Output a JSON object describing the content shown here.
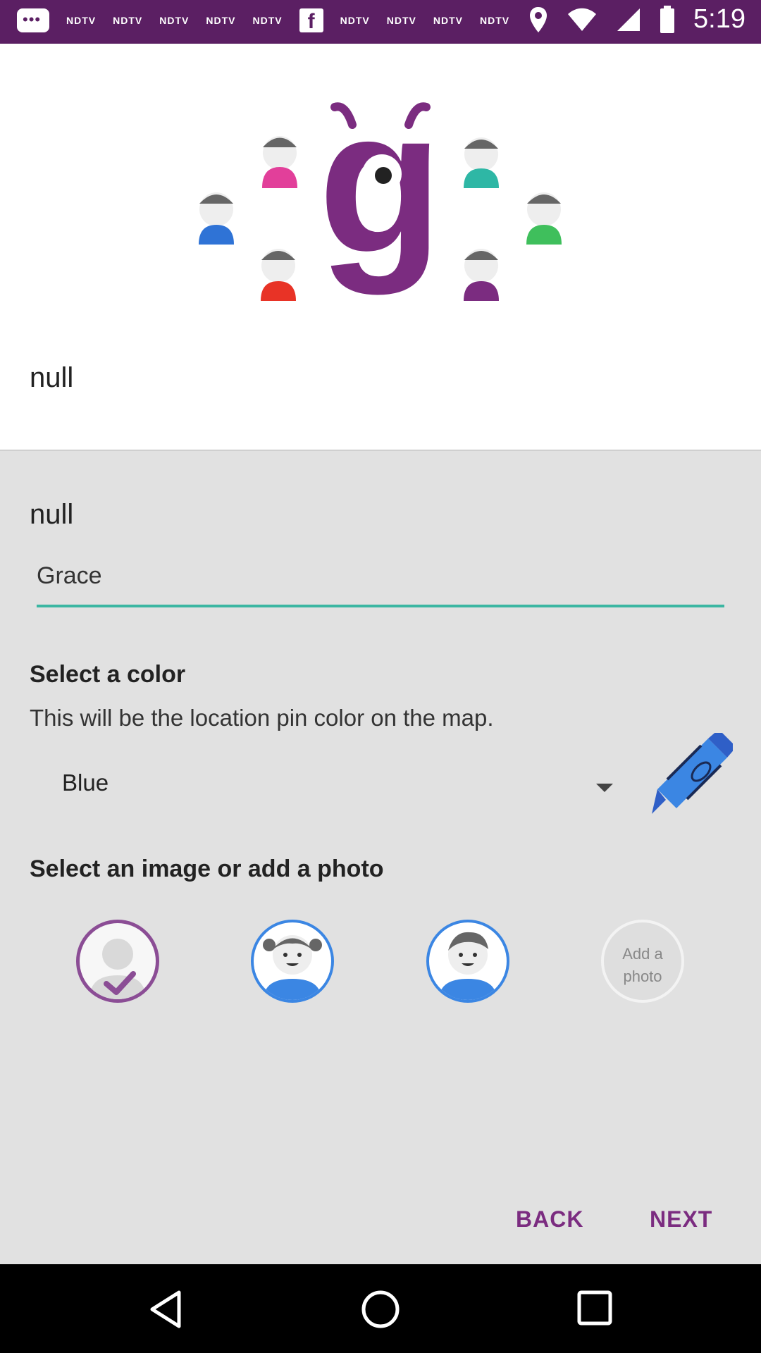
{
  "status_bar": {
    "time": "5:19",
    "notifications": [
      "NDTV",
      "NDTV",
      "NDTV",
      "NDTV",
      "NDTV",
      "NDTV",
      "NDTV",
      "NDTV",
      "NDTV"
    ],
    "icons": [
      "chat-icon",
      "facebook-icon",
      "location-icon",
      "wifi-icon",
      "signal-icon",
      "battery-icon"
    ]
  },
  "header": {
    "logo_letter": "g",
    "title_null": "null"
  },
  "form": {
    "label_null": "null",
    "name_value": "Grace",
    "color_section": {
      "title": "Select a color",
      "subtitle": "This will be the location pin color on the map.",
      "selected_color": "Blue"
    },
    "image_section": {
      "title": "Select an image or add a photo",
      "add_photo_line1": "Add a",
      "add_photo_line2": "photo"
    }
  },
  "actions": {
    "back_label": "BACK",
    "next_label": "NEXT"
  },
  "colors": {
    "status_bar": "#5b1f63",
    "accent_purple": "#7b2c80",
    "input_underline": "#3bb6a2",
    "avatar_border_blue": "#3b86e3"
  }
}
